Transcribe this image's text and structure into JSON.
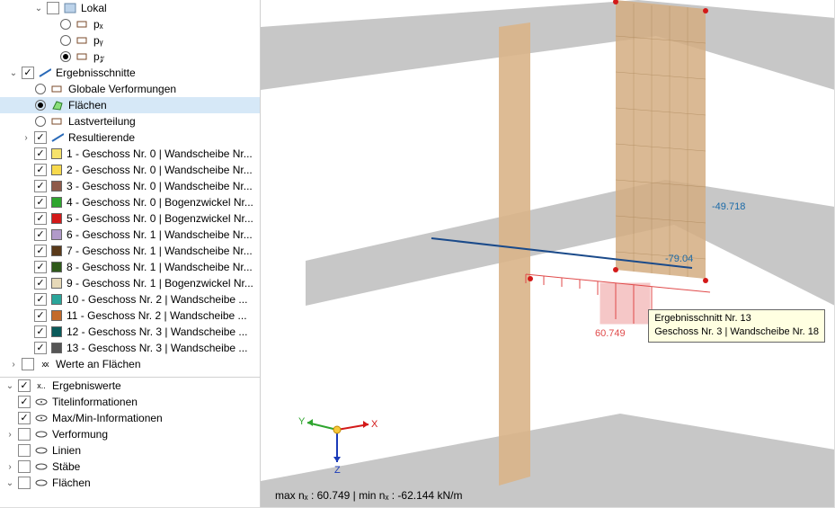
{
  "tree_upper": {
    "lokal": {
      "label": "Lokal",
      "px": "pₓ",
      "py": "pᵧ",
      "pz": "p𝓏"
    },
    "ergebnisschnitte": {
      "label": "Ergebnisschnitte",
      "globale": "Globale Verformungen",
      "flaechen": "Flächen",
      "lastverteilung": "Lastverteilung",
      "resultierende": "Resultierende",
      "items": [
        {
          "color": "#f6e26b",
          "label": "1 - Geschoss Nr. 0 | Wandscheibe Nr..."
        },
        {
          "color": "#f7d94c",
          "label": "2 - Geschoss Nr. 0 | Wandscheibe Nr..."
        },
        {
          "color": "#8e5a4a",
          "label": "3 - Geschoss Nr. 0 | Wandscheibe Nr..."
        },
        {
          "color": "#2fa52f",
          "label": "4 - Geschoss Nr. 0 | Bogenzwickel Nr..."
        },
        {
          "color": "#d31919",
          "label": "5 - Geschoss Nr. 0 | Bogenzwickel Nr..."
        },
        {
          "color": "#b19ac9",
          "label": "6 - Geschoss Nr. 1 | Wandscheibe Nr..."
        },
        {
          "color": "#5a3a1a",
          "label": "7 - Geschoss Nr. 1 | Wandscheibe Nr..."
        },
        {
          "color": "#2f5a1a",
          "label": "8 - Geschoss Nr. 1 | Wandscheibe Nr..."
        },
        {
          "color": "#e6d9b8",
          "label": "9 - Geschoss Nr. 1 | Bogenzwickel Nr..."
        },
        {
          "color": "#2aa59a",
          "label": "10 - Geschoss Nr. 2 | Wandscheibe ..."
        },
        {
          "color": "#c36a2a",
          "label": "11 - Geschoss Nr. 2 | Wandscheibe ..."
        },
        {
          "color": "#0a5a5a",
          "label": "12 - Geschoss Nr. 3 | Wandscheibe ..."
        },
        {
          "color": "#555555",
          "label": "13 - Geschoss Nr. 3 | Wandscheibe ..."
        }
      ]
    },
    "werte": "Werte an Flächen"
  },
  "tree_lower": {
    "ergebniswerte": "Ergebniswerte",
    "titelinfo": "Titelinformationen",
    "maxmin": "Max/Min-Informationen",
    "verformung": "Verformung",
    "linien": "Linien",
    "staebe": "Stäbe",
    "flaechen": "Flächen"
  },
  "viewport": {
    "value_top": "-49.718",
    "value_mid": "-79.04",
    "value_bottom": "60.749",
    "axes": {
      "x": "X",
      "y": "Y",
      "z": "Z"
    },
    "status_prefix": "max nₓ : ",
    "status_max": "60.749",
    "status_sep": " | min nₓ : ",
    "status_min": "-62.144 kN/m",
    "tooltip_line1": "Ergebnisschnitt Nr. 13",
    "tooltip_line2": "Geschoss Nr. 3 | Wandscheibe Nr. 18"
  }
}
